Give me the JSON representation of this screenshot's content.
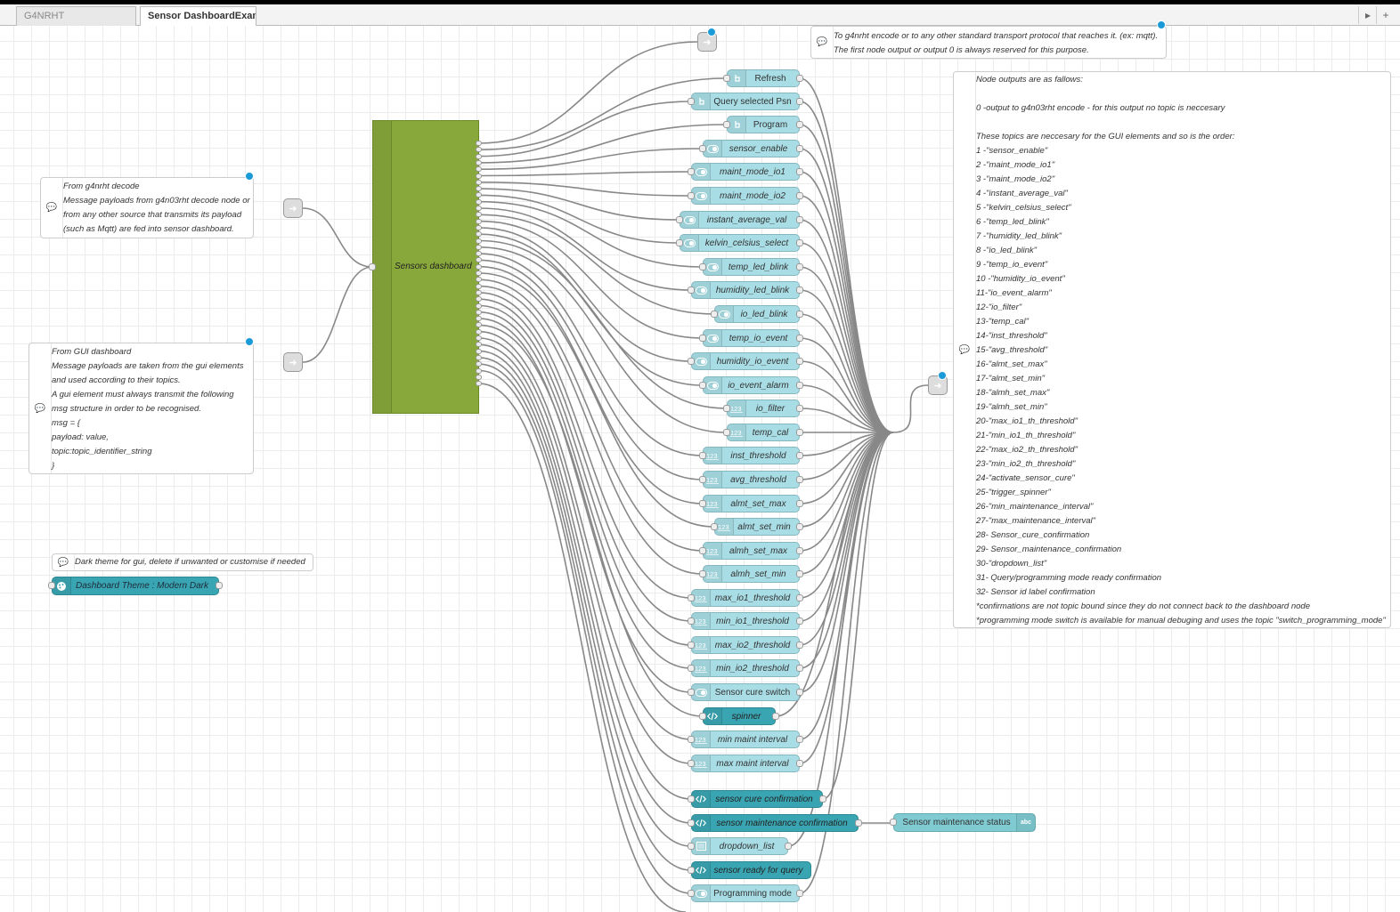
{
  "tabs": [
    "G4NRHT",
    "Sensor DashboardExample"
  ],
  "tab_controls": {
    "scroll_right": "▸",
    "add": "+"
  },
  "dashboard_node": {
    "label": "Sensors dashboard",
    "color": "#88a83b"
  },
  "comments": {
    "top": [
      "To g4nrht encode or to any other standard transport protocol that reaches it. (ex: mqtt).",
      "The first node output or output 0 is always reserved for this purpose."
    ],
    "decode": [
      "From g4nrht decode",
      "Message payloads from g4n03rht decode node or",
      "from any other source that transmits its payload",
      "(such as Mqtt) are fed into sensor dashboard."
    ],
    "gui": [
      "From GUI dashboard",
      "Message payloads are taken from the gui elements",
      "and used according to their topics.",
      "A gui element must always transmit the following",
      "msg structure in order to be recognised.",
      "msg = {",
      "payload: value,",
      "topic:topic_identifier_string",
      "}"
    ],
    "dark": [
      "Dark theme for gui, delete if unwanted or customise if needed"
    ],
    "outputs": [
      "Node outputs are as fallows:",
      "",
      "0 -output to g4n03rht encode - for this output no topic is neccesary",
      "",
      "These topics are neccesary for the GUI elements and so is the order:",
      "1 -\"sensor_enable\"",
      "2 -\"maint_mode_io1\"",
      "3 -\"maint_mode_io2\"",
      "4 -\"instant_average_val\"",
      "5 -\"kelvin_celsius_select\"",
      "6 -\"temp_led_blink\"",
      "7 -\"humidity_led_blink\"",
      "8 -\"io_led_blink\"",
      "9 -\"temp_io_event\"",
      "10 -\"humidity_io_event\"",
      "11-\"io_event_alarm\"",
      "12-\"io_filter\"",
      "13-\"temp_cal\"",
      "14-\"inst_threshold\"",
      "15-\"avg_threshold\"",
      "16-\"almt_set_max\"",
      "17-\"almt_set_min\"",
      "18-\"almh_set_max\"",
      "19-\"almh_set_min\"",
      "20-\"max_io1_th_threshold\"",
      "21-\"min_io1_th_threshold\"",
      "22-\"max_io2_th_threshold\"",
      "23-\"min_io2_th_threshold\"",
      "24-\"activate_sensor_cure\"",
      "25-\"trigger_spinner\"",
      "26-\"min_maintenance_interval\"",
      "27-\"max_maintenance_interval\"",
      "28- Sensor_cure_confirmation",
      "29- Sensor_maintenance_confirmation",
      "30-\"dropdown_list\"",
      "31- Query/programming mode ready confirmation",
      "32- Sensor id label confirmation",
      "*confirmations are not topic bound since they do not connect back to the dashboard node",
      "*programming mode switch is available for manual debuging and uses the topic \"switch_programming_mode\""
    ]
  },
  "theme_node": {
    "label": "Dashboard Theme : Modern Dark"
  },
  "status_node": {
    "label": "Sensor maintenance status",
    "badge": "abc"
  },
  "gui_nodes": [
    {
      "label": "Refresh",
      "kind": "button",
      "italic": false
    },
    {
      "label": "Query selected Psn",
      "kind": "button",
      "italic": false
    },
    {
      "label": "Program",
      "kind": "button",
      "italic": false
    },
    {
      "label": "sensor_enable",
      "kind": "switch",
      "italic": true
    },
    {
      "label": "maint_mode_io1",
      "kind": "switch",
      "italic": true
    },
    {
      "label": "maint_mode_io2",
      "kind": "switch",
      "italic": true
    },
    {
      "label": "instant_average_val",
      "kind": "switch",
      "italic": true
    },
    {
      "label": "kelvin_celsius_select",
      "kind": "switch",
      "italic": true
    },
    {
      "label": "temp_led_blink",
      "kind": "switch",
      "italic": true
    },
    {
      "label": "humidity_led_blink",
      "kind": "switch",
      "italic": true
    },
    {
      "label": "io_led_blink",
      "kind": "switch",
      "italic": true
    },
    {
      "label": "temp_io_event",
      "kind": "switch",
      "italic": true
    },
    {
      "label": "humidity_io_event",
      "kind": "switch",
      "italic": true
    },
    {
      "label": "io_event_alarm",
      "kind": "switch",
      "italic": true
    },
    {
      "label": "io_filter",
      "kind": "numeric",
      "italic": true
    },
    {
      "label": "temp_cal",
      "kind": "numeric",
      "italic": true
    },
    {
      "label": "inst_threshold",
      "kind": "numeric",
      "italic": true
    },
    {
      "label": "avg_threshold",
      "kind": "numeric",
      "italic": true
    },
    {
      "label": "almt_set_max",
      "kind": "numeric",
      "italic": true
    },
    {
      "label": "almt_set_min",
      "kind": "numeric",
      "italic": true
    },
    {
      "label": "almh_set_max",
      "kind": "numeric",
      "italic": true
    },
    {
      "label": "almh_set_min",
      "kind": "numeric",
      "italic": true
    },
    {
      "label": "max_io1_threshold",
      "kind": "numeric",
      "italic": true
    },
    {
      "label": "min_io1_threshold",
      "kind": "numeric",
      "italic": true
    },
    {
      "label": "max_io2_threshold",
      "kind": "numeric",
      "italic": true
    },
    {
      "label": "min_io2_threshold",
      "kind": "numeric",
      "italic": true
    },
    {
      "label": "Sensor cure switch",
      "kind": "switch",
      "italic": false
    },
    {
      "label": "spinner",
      "kind": "template",
      "italic": true
    },
    {
      "label": "min maint interval",
      "kind": "numeric",
      "italic": true
    },
    {
      "label": "max maint interval",
      "kind": "numeric",
      "italic": true
    },
    {
      "label": "sensor cure confirmation",
      "kind": "template",
      "italic": true
    },
    {
      "label": "sensor maintenance confirmation",
      "kind": "template",
      "italic": true
    },
    {
      "label": "dropdown_list",
      "kind": "dropdown",
      "italic": true
    },
    {
      "label": "sensor ready for query",
      "kind": "template",
      "italic": true
    },
    {
      "label": "Programming mode",
      "kind": "switch",
      "italic": false
    }
  ]
}
